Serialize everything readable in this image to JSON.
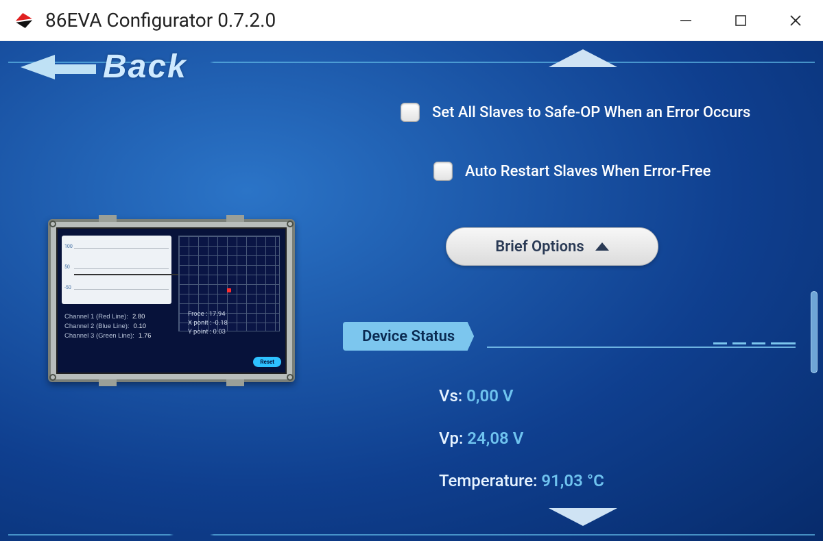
{
  "window": {
    "title": "86EVA Configurator 0.7.2.0"
  },
  "back_label": "Back",
  "options": {
    "safe_op": {
      "label": "Set All Slaves to Safe-OP When an Error Occurs",
      "checked": false
    },
    "auto_restart": {
      "label": "Auto Restart Slaves When Error-Free",
      "checked": false
    }
  },
  "brief_options_label": "Brief Options",
  "device_status": {
    "header": "Device Status",
    "vs": {
      "label": "Vs:",
      "value": "0,00 V"
    },
    "vp": {
      "label": "Vp:",
      "value": "24,08 V"
    },
    "temperature": {
      "label": "Temperature:",
      "value": "91,03 °C"
    }
  },
  "device_screen": {
    "chart_ticks": {
      "t1": "100",
      "t2": "50",
      "t3": "-50"
    },
    "channels": {
      "ch1": {
        "label": "Channel 1 (Red Line):",
        "value": "2.80"
      },
      "ch2": {
        "label": "Channel 2 (Blue Line):",
        "value": "0.10"
      },
      "ch3": {
        "label": "Channel 3 (Green Line):",
        "value": "1.76"
      }
    },
    "readouts": {
      "force": {
        "label": "Froce :",
        "value": "17.94"
      },
      "xpoint": {
        "label": "X ponit :",
        "value": "-0.18"
      },
      "ypoint": {
        "label": "Y point :",
        "value": "0.03"
      }
    },
    "reset_label": "Reset"
  }
}
